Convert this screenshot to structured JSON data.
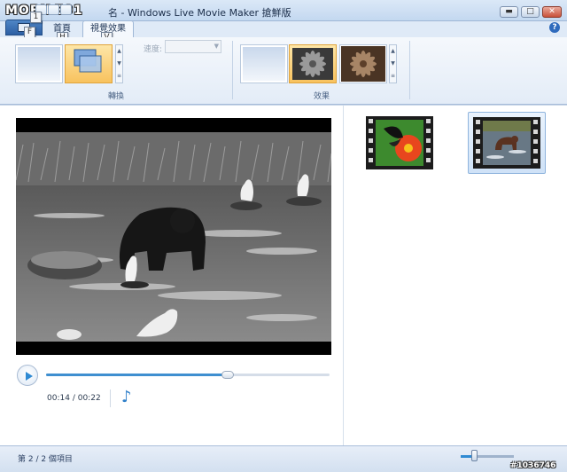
{
  "window": {
    "title": "名 - Windows Live Movie Maker 搶鮮版",
    "logo_text": "MOBILE01",
    "watermark": "#1036746",
    "controls": {
      "minimize": "▬",
      "maximize": "□",
      "close": "✕"
    }
  },
  "keytips": {
    "file": "F",
    "qat1": "1",
    "home": "H",
    "visual": "V"
  },
  "tabs": [
    {
      "label": "首頁",
      "active": false
    },
    {
      "label": "視覺效果",
      "active": true
    }
  ],
  "help_label": "?",
  "ribbon": {
    "transitions_group": {
      "label": "轉換"
    },
    "speed": {
      "label": "速度:",
      "value": ""
    },
    "effects_group": {
      "label": "效果"
    }
  },
  "player": {
    "current_time": "00:14",
    "separator": "/",
    "total_time": "00:22",
    "progress": 0.64
  },
  "storyboard": {
    "clips": [
      {
        "name": "butterfly-clip",
        "selected": false
      },
      {
        "name": "bear-clip",
        "selected": true
      }
    ]
  },
  "status": {
    "item_count": "第 2 / 2 個項目",
    "zoom_level": 0.25
  },
  "colors": {
    "accent": "#2f8ad3",
    "selection": "#f8c25e"
  },
  "icons": [
    "play-icon",
    "music-note-icon",
    "help-icon",
    "minimize-icon",
    "maximize-icon",
    "close-icon"
  ]
}
